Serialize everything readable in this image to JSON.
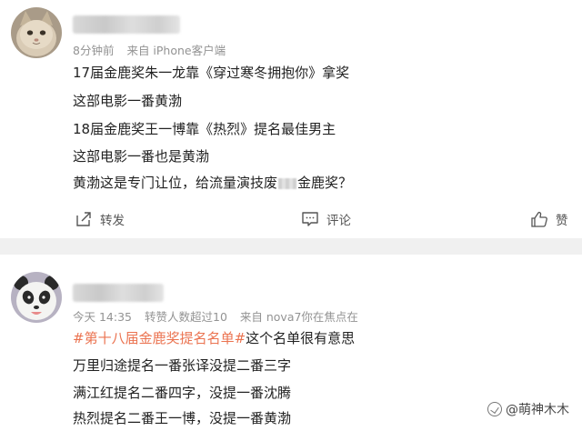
{
  "post1": {
    "time": "8分钟前",
    "source": "来自 iPhone客户端",
    "lines": [
      "17届金鹿奖朱一龙靠《穿过寒冬拥抱你》拿奖",
      "这部电影一番黄渤",
      "18届金鹿奖王一博靠《热烈》提名最佳男主",
      "这部电影一番也是黄渤"
    ],
    "last_line_before": "黄渤这是专门让位，给流量演技废",
    "last_line_after": "金鹿奖？",
    "actions": {
      "repost": "转发",
      "comment": "评论",
      "like": "赞"
    }
  },
  "post2": {
    "meta_time": "今天 14:35",
    "meta_reposts": "转赞人数超过10",
    "meta_source": "来自 nova7你在焦点在",
    "hashtag": "#第十八届金鹿奖提名名单#",
    "hashtag_tail": "这个名单很有意思",
    "lines": [
      "万里归途提名一番张译没提二番三字",
      "满江红提名二番四字，没提一番沈腾",
      "热烈提名二番王一博，没提一番黄渤"
    ]
  },
  "watermark": "@萌神木木",
  "colors": {
    "hashtag": "#eb7350",
    "meta": "#939393",
    "divider": "#f0f0f0"
  }
}
